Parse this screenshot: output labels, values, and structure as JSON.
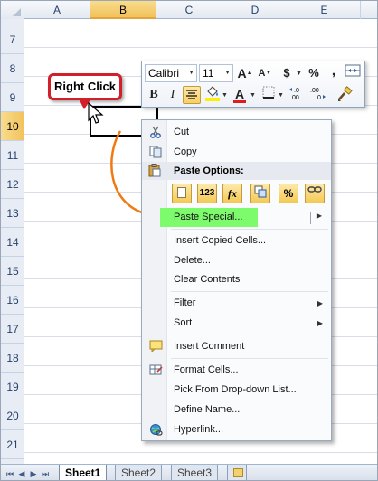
{
  "columns": [
    "A",
    "B",
    "C",
    "D",
    "E"
  ],
  "selected_column": "B",
  "rows": [
    "7",
    "8",
    "9",
    "10",
    "11",
    "12",
    "13",
    "14",
    "15",
    "16",
    "17",
    "18",
    "19",
    "20",
    "21"
  ],
  "selected_row": "10",
  "callout": {
    "text": "Right Click",
    "color": "#d2202a"
  },
  "mini_toolbar": {
    "font_name": "Calibri",
    "font_size": "11",
    "grow_font": "A",
    "shrink_font": "A",
    "currency": "$",
    "percent": "%",
    "comma": ",",
    "bold": "B",
    "italic": "I",
    "font_color_letter": "A",
    "increase_decimal": "←.00\n.0",
    "decrease_decimal": ".00→.0"
  },
  "context_menu": {
    "cut": "Cut",
    "copy": "Copy",
    "paste_options_title": "Paste Options:",
    "paste_options": [
      {
        "icon": "paste-icon",
        "text": ""
      },
      {
        "icon": "paste-values-icon",
        "text": "123"
      },
      {
        "icon": "paste-formulas-icon",
        "text": "fx"
      },
      {
        "icon": "paste-transpose-icon",
        "text": ""
      },
      {
        "icon": "paste-formatting-icon",
        "text": "%"
      },
      {
        "icon": "paste-link-icon",
        "text": ""
      }
    ],
    "paste_special": "Paste Special...",
    "insert_copied_cells": "Insert Copied Cells...",
    "delete": "Delete...",
    "clear_contents": "Clear Contents",
    "filter": "Filter",
    "sort": "Sort",
    "insert_comment": "Insert Comment",
    "format_cells": "Format Cells...",
    "pick_from_list": "Pick From Drop-down List...",
    "define_name": "Define Name...",
    "hyperlink": "Hyperlink...",
    "highlight_color": "#7dfb6d"
  },
  "sheet_tabs": [
    "Sheet1",
    "Sheet2",
    "Sheet3"
  ],
  "active_sheet": "Sheet1",
  "colors": {
    "selection_header": "#f1c25c",
    "arrow": "#f07a12"
  }
}
